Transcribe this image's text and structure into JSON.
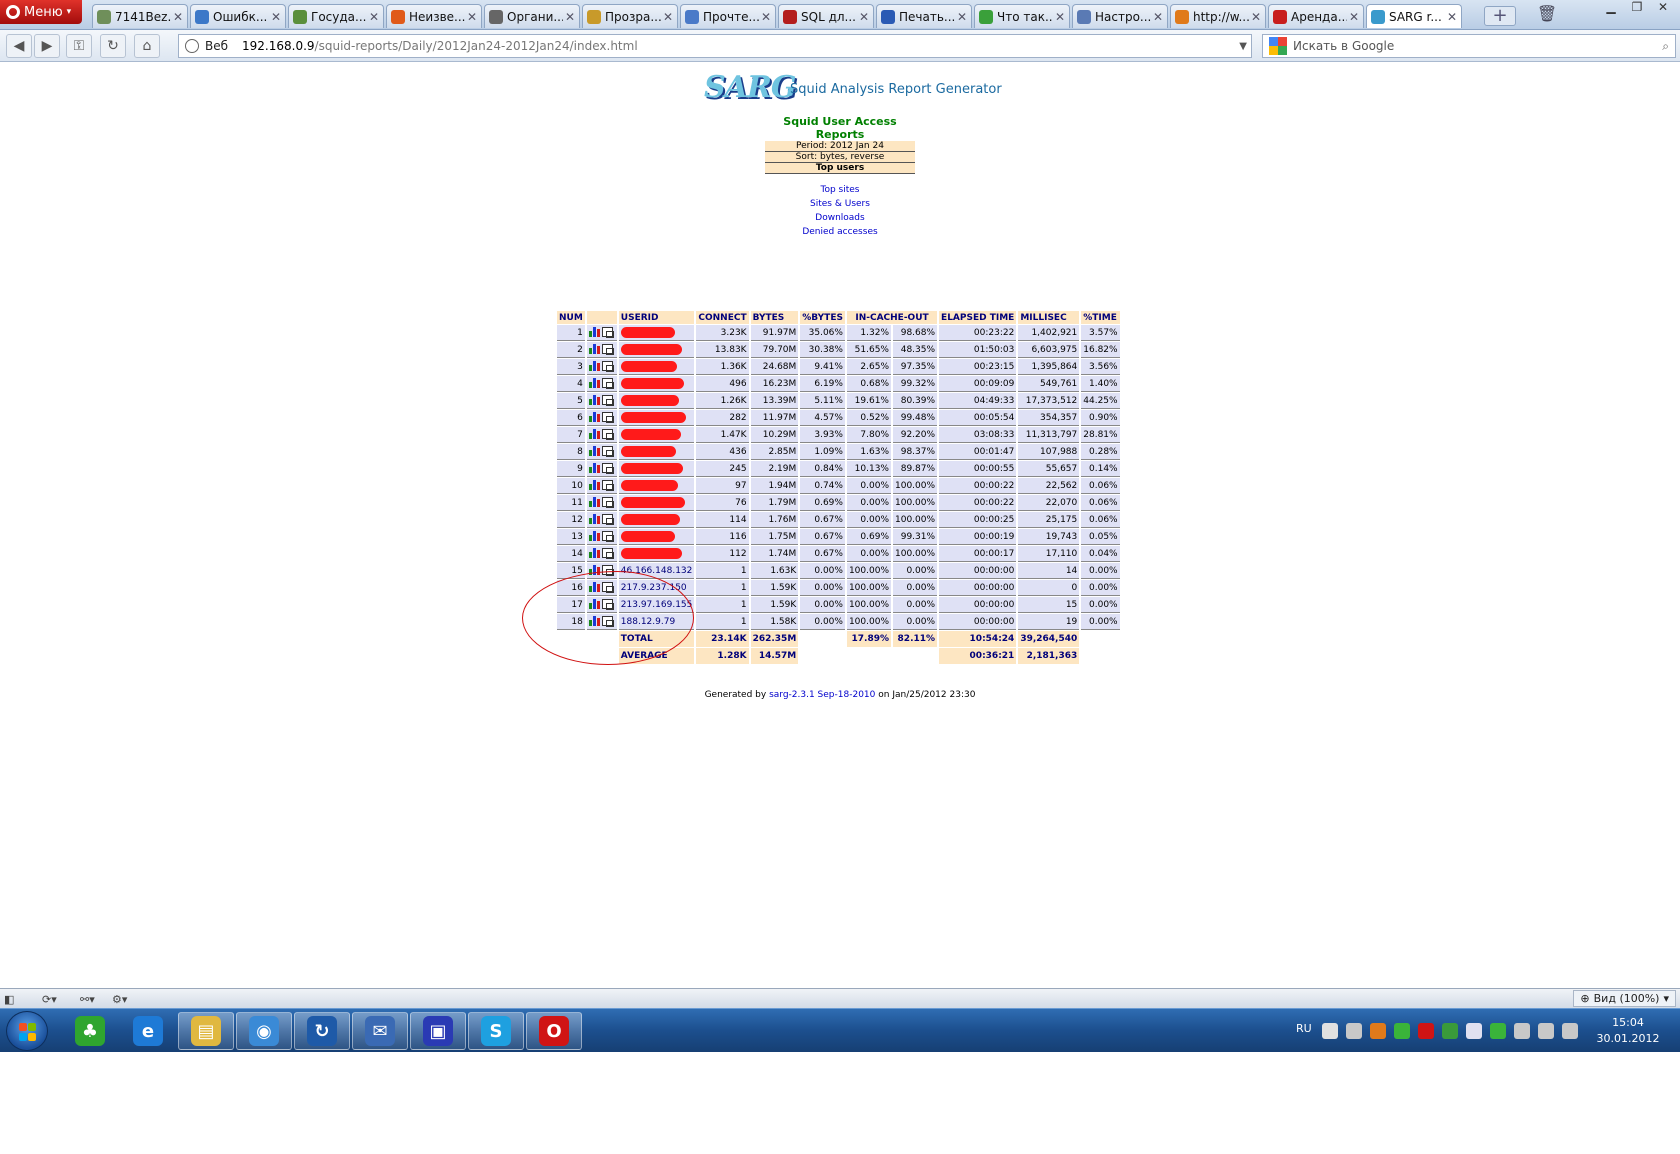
{
  "browser": {
    "menu_label": "Меню",
    "tabs": [
      {
        "label": "7141Bez...",
        "color": "#6f8f5a"
      },
      {
        "label": "Ошибк...",
        "color": "#3c78c8"
      },
      {
        "label": "Госуда...",
        "color": "#5a8f3c"
      },
      {
        "label": "Неизве...",
        "color": "#e05a1a"
      },
      {
        "label": "Органи...",
        "color": "#666666"
      },
      {
        "label": "Прозра...",
        "color": "#c89a2a"
      },
      {
        "label": "Прочте...",
        "color": "#4a7ac8"
      },
      {
        "label": "SQL дл...",
        "color": "#b41e1e"
      },
      {
        "label": "Печать...",
        "color": "#2a5ab4"
      },
      {
        "label": "Что так...",
        "color": "#3aa03a"
      },
      {
        "label": "Настро...",
        "color": "#5a7ab4"
      },
      {
        "label": "http://w...",
        "color": "#e07a1a"
      },
      {
        "label": "Аренда...",
        "color": "#c81e1e"
      },
      {
        "label": "SARG r...",
        "color": "#3a9acc",
        "active": true
      }
    ],
    "address": {
      "scheme_label": "Веб",
      "host": "192.168.0.9",
      "path": "/squid-reports/Daily/2012Jan24-2012Jan24/index.html"
    },
    "search_placeholder": "Искать в Google",
    "zoom_label": "Вид (100%)"
  },
  "report": {
    "logo_text": "SARG",
    "logo_title": "Squid Analysis Report Generator",
    "heading": "Squid User Access Reports",
    "period": "Period: 2012 Jan 24",
    "sort": "Sort: bytes, reverse",
    "section": "Top users",
    "links": [
      "Top sites",
      "Sites & Users",
      "Downloads",
      "Denied accesses"
    ],
    "columns": [
      "NUM",
      "",
      "USERID",
      "CONNECT",
      "BYTES",
      "%BYTES",
      "IN-CACHE-OUT",
      "",
      "ELAPSED TIME",
      "MILLISEC",
      "%TIME"
    ],
    "rows": [
      {
        "num": "1",
        "userid": "",
        "redacted": true,
        "connect": "3.23K",
        "bytes": "91.97M",
        "pbytes": "35.06%",
        "in": "1.32%",
        "out": "98.68%",
        "elapsed": "00:23:22",
        "ms": "1,402,921",
        "ptime": "3.57%"
      },
      {
        "num": "2",
        "userid": "",
        "redacted": true,
        "connect": "13.83K",
        "bytes": "79.70M",
        "pbytes": "30.38%",
        "in": "51.65%",
        "out": "48.35%",
        "elapsed": "01:50:03",
        "ms": "6,603,975",
        "ptime": "16.82%"
      },
      {
        "num": "3",
        "userid": "",
        "redacted": true,
        "connect": "1.36K",
        "bytes": "24.68M",
        "pbytes": "9.41%",
        "in": "2.65%",
        "out": "97.35%",
        "elapsed": "00:23:15",
        "ms": "1,395,864",
        "ptime": "3.56%"
      },
      {
        "num": "4",
        "userid": "",
        "redacted": true,
        "connect": "496",
        "bytes": "16.23M",
        "pbytes": "6.19%",
        "in": "0.68%",
        "out": "99.32%",
        "elapsed": "00:09:09",
        "ms": "549,761",
        "ptime": "1.40%"
      },
      {
        "num": "5",
        "userid": "",
        "redacted": true,
        "connect": "1.26K",
        "bytes": "13.39M",
        "pbytes": "5.11%",
        "in": "19.61%",
        "out": "80.39%",
        "elapsed": "04:49:33",
        "ms": "17,373,512",
        "ptime": "44.25%"
      },
      {
        "num": "6",
        "userid": "",
        "redacted": true,
        "connect": "282",
        "bytes": "11.97M",
        "pbytes": "4.57%",
        "in": "0.52%",
        "out": "99.48%",
        "elapsed": "00:05:54",
        "ms": "354,357",
        "ptime": "0.90%"
      },
      {
        "num": "7",
        "userid": "",
        "redacted": true,
        "connect": "1.47K",
        "bytes": "10.29M",
        "pbytes": "3.93%",
        "in": "7.80%",
        "out": "92.20%",
        "elapsed": "03:08:33",
        "ms": "11,313,797",
        "ptime": "28.81%"
      },
      {
        "num": "8",
        "userid": "",
        "redacted": true,
        "connect": "436",
        "bytes": "2.85M",
        "pbytes": "1.09%",
        "in": "1.63%",
        "out": "98.37%",
        "elapsed": "00:01:47",
        "ms": "107,988",
        "ptime": "0.28%"
      },
      {
        "num": "9",
        "userid": "",
        "redacted": true,
        "connect": "245",
        "bytes": "2.19M",
        "pbytes": "0.84%",
        "in": "10.13%",
        "out": "89.87%",
        "elapsed": "00:00:55",
        "ms": "55,657",
        "ptime": "0.14%"
      },
      {
        "num": "10",
        "userid": "",
        "redacted": true,
        "connect": "97",
        "bytes": "1.94M",
        "pbytes": "0.74%",
        "in": "0.00%",
        "out": "100.00%",
        "elapsed": "00:00:22",
        "ms": "22,562",
        "ptime": "0.06%"
      },
      {
        "num": "11",
        "userid": "",
        "redacted": true,
        "connect": "76",
        "bytes": "1.79M",
        "pbytes": "0.69%",
        "in": "0.00%",
        "out": "100.00%",
        "elapsed": "00:00:22",
        "ms": "22,070",
        "ptime": "0.06%"
      },
      {
        "num": "12",
        "userid": "",
        "redacted": true,
        "connect": "114",
        "bytes": "1.76M",
        "pbytes": "0.67%",
        "in": "0.00%",
        "out": "100.00%",
        "elapsed": "00:00:25",
        "ms": "25,175",
        "ptime": "0.06%"
      },
      {
        "num": "13",
        "userid": "",
        "redacted": true,
        "connect": "116",
        "bytes": "1.75M",
        "pbytes": "0.67%",
        "in": "0.69%",
        "out": "99.31%",
        "elapsed": "00:00:19",
        "ms": "19,743",
        "ptime": "0.05%"
      },
      {
        "num": "14",
        "userid": "",
        "redacted": true,
        "connect": "112",
        "bytes": "1.74M",
        "pbytes": "0.67%",
        "in": "0.00%",
        "out": "100.00%",
        "elapsed": "00:00:17",
        "ms": "17,110",
        "ptime": "0.04%"
      },
      {
        "num": "15",
        "userid": "46.166.148.132",
        "connect": "1",
        "bytes": "1.63K",
        "pbytes": "0.00%",
        "in": "100.00%",
        "out": "0.00%",
        "elapsed": "00:00:00",
        "ms": "14",
        "ptime": "0.00%"
      },
      {
        "num": "16",
        "userid": "217.9.237.150",
        "connect": "1",
        "bytes": "1.59K",
        "pbytes": "0.00%",
        "in": "100.00%",
        "out": "0.00%",
        "elapsed": "00:00:00",
        "ms": "0",
        "ptime": "0.00%"
      },
      {
        "num": "17",
        "userid": "213.97.169.155",
        "connect": "1",
        "bytes": "1.59K",
        "pbytes": "0.00%",
        "in": "100.00%",
        "out": "0.00%",
        "elapsed": "00:00:00",
        "ms": "15",
        "ptime": "0.00%"
      },
      {
        "num": "18",
        "userid": "188.12.9.79",
        "connect": "1",
        "bytes": "1.58K",
        "pbytes": "0.00%",
        "in": "100.00%",
        "out": "0.00%",
        "elapsed": "00:00:00",
        "ms": "19",
        "ptime": "0.00%"
      }
    ],
    "total": {
      "label": "TOTAL",
      "connect": "23.14K",
      "bytes": "262.35M",
      "in": "17.89%",
      "out": "82.11%",
      "elapsed": "10:54:24",
      "ms": "39,264,540"
    },
    "average": {
      "label": "AVERAGE",
      "connect": "1.28K",
      "bytes": "14.57M",
      "elapsed": "00:36:21",
      "ms": "2,181,363"
    },
    "footer": {
      "prefix": "Generated by",
      "link": "sarg-2.3.1 Sep-18-2010",
      "suffix": "on Jan/25/2012 23:30"
    }
  },
  "taskbar": {
    "apps": [
      {
        "name": "clover",
        "color": "#2fa52f"
      },
      {
        "name": "internet-explorer",
        "color": "#1e7ad6"
      },
      {
        "name": "explorer",
        "color": "#e0b840"
      },
      {
        "name": "app-globe",
        "color": "#3a8ad6"
      },
      {
        "name": "app-refresh",
        "color": "#1e5aa8"
      },
      {
        "name": "thunderbird",
        "color": "#3a6ab4"
      },
      {
        "name": "floppy",
        "color": "#2a3ab4"
      },
      {
        "name": "skype",
        "color": "#1ea0e0"
      },
      {
        "name": "opera",
        "color": "#d01414"
      }
    ],
    "lang": "RU",
    "tray_colors": [
      "#e0e0e0",
      "#c8c8c8",
      "#e07a1a",
      "#3ab43a",
      "#d01414",
      "#3a9a3a",
      "#e0e0f0",
      "#3ab43a",
      "#c8c8c8",
      "#c8c8c8",
      "#c8c8c8"
    ],
    "time": "15:04",
    "date": "30.01.2012"
  }
}
